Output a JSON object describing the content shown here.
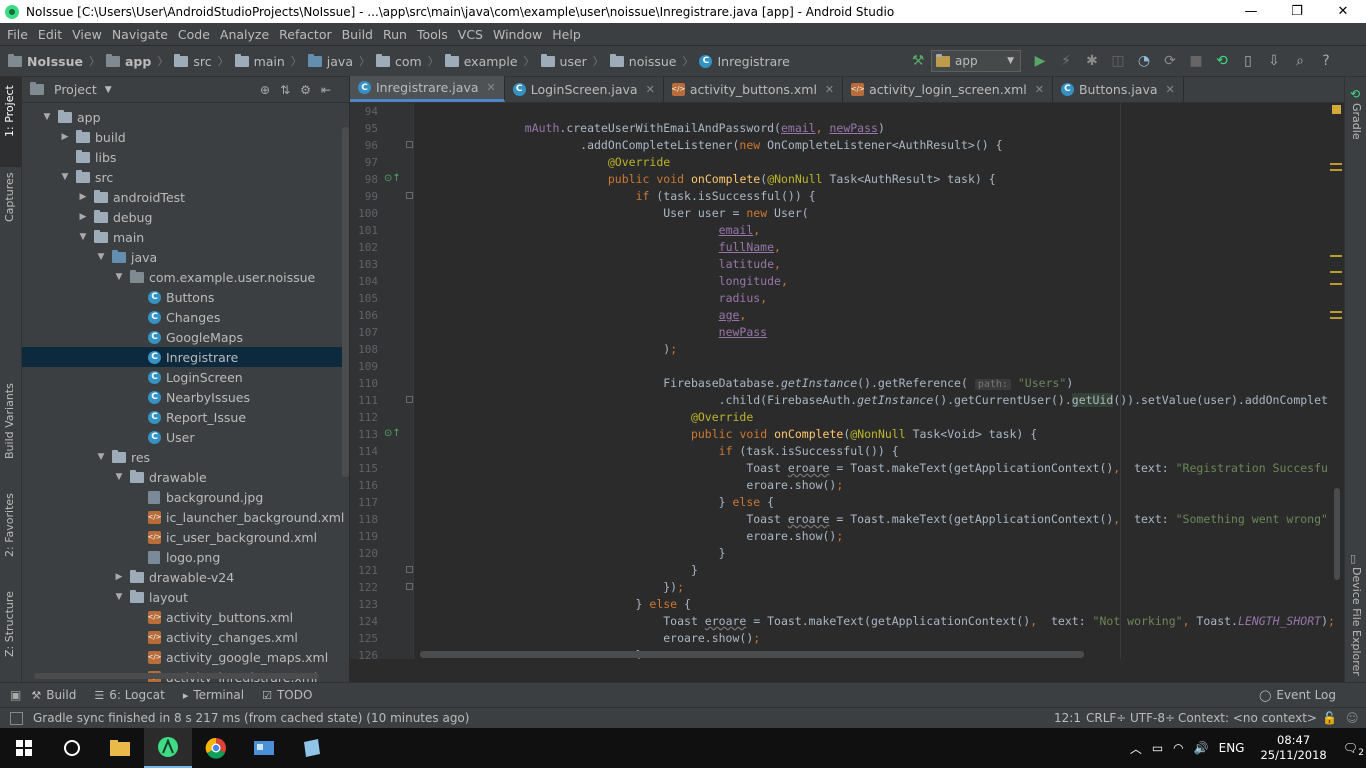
{
  "window": {
    "title": "NoIssue [C:\\Users\\User\\AndroidStudioProjects\\NoIssue] - ...\\app\\src\\main\\java\\com\\example\\user\\noissue\\Inregistrare.java [app] - Android Studio",
    "minimize": "—",
    "restore": "❐",
    "close": "✕"
  },
  "menu": [
    "File",
    "Edit",
    "View",
    "Navigate",
    "Code",
    "Analyze",
    "Refactor",
    "Build",
    "Run",
    "Tools",
    "VCS",
    "Window",
    "Help"
  ],
  "breadcrumb": [
    "NoIssue",
    "app",
    "src",
    "main",
    "java",
    "com",
    "example",
    "user",
    "noissue",
    "Inregistrare"
  ],
  "run_config": "app",
  "left_tool_tabs": [
    "1: Project",
    "Captures",
    "Build Variants",
    "2: Favorites",
    "Z: Structure"
  ],
  "right_tool_tabs": [
    "Gradle",
    "Device File Explorer"
  ],
  "project_panel": {
    "title": "Project",
    "tree": [
      {
        "label": "app",
        "icon": "folder",
        "arrow": "▼",
        "depth": 0
      },
      {
        "label": "build",
        "icon": "folder",
        "arrow": "▶",
        "depth": 1
      },
      {
        "label": "libs",
        "icon": "folder",
        "arrow": "",
        "depth": 1
      },
      {
        "label": "src",
        "icon": "folder",
        "arrow": "▼",
        "depth": 1
      },
      {
        "label": "androidTest",
        "icon": "folder",
        "arrow": "▶",
        "depth": 2
      },
      {
        "label": "debug",
        "icon": "folder",
        "arrow": "▶",
        "depth": 2
      },
      {
        "label": "main",
        "icon": "folder",
        "arrow": "▼",
        "depth": 2
      },
      {
        "label": "java",
        "icon": "folder-blue",
        "arrow": "▼",
        "depth": 3
      },
      {
        "label": "com.example.user.noissue",
        "icon": "package",
        "arrow": "▼",
        "depth": 4
      },
      {
        "label": "Buttons",
        "icon": "class",
        "arrow": "",
        "depth": 5
      },
      {
        "label": "Changes",
        "icon": "class",
        "arrow": "",
        "depth": 5
      },
      {
        "label": "GoogleMaps",
        "icon": "class",
        "arrow": "",
        "depth": 5
      },
      {
        "label": "Inregistrare",
        "icon": "class",
        "arrow": "",
        "depth": 5,
        "selected": true
      },
      {
        "label": "LoginScreen",
        "icon": "class",
        "arrow": "",
        "depth": 5
      },
      {
        "label": "NearbyIssues",
        "icon": "class",
        "arrow": "",
        "depth": 5
      },
      {
        "label": "Report_Issue",
        "icon": "class",
        "arrow": "",
        "depth": 5
      },
      {
        "label": "User",
        "icon": "class",
        "arrow": "",
        "depth": 5
      },
      {
        "label": "res",
        "icon": "folder",
        "arrow": "▼",
        "depth": 3
      },
      {
        "label": "drawable",
        "icon": "folder",
        "arrow": "▼",
        "depth": 4
      },
      {
        "label": "background.jpg",
        "icon": "image",
        "arrow": "",
        "depth": 5
      },
      {
        "label": "ic_launcher_background.xml",
        "icon": "xml",
        "arrow": "",
        "depth": 5
      },
      {
        "label": "ic_user_background.xml",
        "icon": "xml",
        "arrow": "",
        "depth": 5
      },
      {
        "label": "logo.png",
        "icon": "image",
        "arrow": "",
        "depth": 5
      },
      {
        "label": "drawable-v24",
        "icon": "folder",
        "arrow": "▶",
        "depth": 4
      },
      {
        "label": "layout",
        "icon": "folder",
        "arrow": "▼",
        "depth": 4
      },
      {
        "label": "activity_buttons.xml",
        "icon": "xml",
        "arrow": "",
        "depth": 5
      },
      {
        "label": "activity_changes.xml",
        "icon": "xml",
        "arrow": "",
        "depth": 5
      },
      {
        "label": "activity_google_maps.xml",
        "icon": "xml",
        "arrow": "",
        "depth": 5
      },
      {
        "label": "activity_inregistrare.xml",
        "icon": "xml",
        "arrow": "",
        "depth": 5
      }
    ]
  },
  "editor_tabs": [
    {
      "label": "Inregistrare.java",
      "icon": "class",
      "active": true
    },
    {
      "label": "LoginScreen.java",
      "icon": "class",
      "active": false
    },
    {
      "label": "activity_buttons.xml",
      "icon": "xml",
      "active": false
    },
    {
      "label": "activity_login_screen.xml",
      "icon": "xml",
      "active": false
    },
    {
      "label": "Buttons.java",
      "icon": "class",
      "active": false
    }
  ],
  "code": {
    "line_numbers": [
      "94",
      "95",
      "96",
      "97",
      "98",
      "99",
      "100",
      "101",
      "102",
      "103",
      "104",
      "105",
      "106",
      "107",
      "108",
      "109",
      "110",
      "111",
      "112",
      "113",
      "114",
      "115",
      "116",
      "117",
      "118",
      "119",
      "120",
      "121",
      "122",
      "123",
      "124",
      "125",
      "126"
    ],
    "lines": [
      "",
      "                mAuth.createUserWithEmailAndPassword(email, newPass)",
      "                        .addOnCompleteListener(new OnCompleteListener<AuthResult>() {",
      "                            @Override",
      "                            public void onComplete(@NonNull Task<AuthResult> task) {",
      "                                if (task.isSuccessful()) {",
      "                                    User user = new User(",
      "                                            email,",
      "                                            fullName,",
      "                                            latitude,",
      "                                            longitude,",
      "                                            radius,",
      "                                            age,",
      "                                            newPass",
      "                                    );",
      "",
      "                                    FirebaseDatabase.getInstance().getReference( path: \"Users\")",
      "                                            .child(FirebaseAuth.getInstance().getCurrentUser().getUid()).setValue(user).addOnComplet",
      "                                        @Override",
      "                                        public void onComplete(@NonNull Task<Void> task) {",
      "                                            if (task.isSuccessful()) {",
      "                                                Toast eroare = Toast.makeText(getApplicationContext(),  text: \"Registration Succesfu",
      "                                                eroare.show();",
      "                                            } else {",
      "                                                Toast eroare = Toast.makeText(getApplicationContext(),  text: \"Something went wrong\"",
      "                                                eroare.show();",
      "                                            }",
      "                                        }",
      "                                    });",
      "                                } else {",
      "                                    Toast eroare = Toast.makeText(getApplicationContext(),  text: \"Not working\", Toast.LENGTH_SHORT);",
      "                                    eroare.show();",
      "                                }"
    ]
  },
  "bottom_tabs": [
    {
      "label": "Build",
      "icon": "hammer-icon"
    },
    {
      "label": "6: Logcat",
      "icon": "logcat-icon"
    },
    {
      "label": "Terminal",
      "icon": "terminal-icon"
    },
    {
      "label": "TODO",
      "icon": "todo-icon"
    }
  ],
  "event_log": "Event Log",
  "status": {
    "message": "Gradle sync finished in 8 s 217 ms (from cached state) (10 minutes ago)",
    "position": "12:1",
    "line_sep": "CRLF÷",
    "encoding": "UTF-8÷",
    "context": "Context: <no context>"
  },
  "taskbar": {
    "language": "ENG",
    "time": "08:47",
    "date": "25/11/2018",
    "notifications": "2"
  },
  "colors": {
    "keyword": "#cc7832",
    "annotation": "#bbb529",
    "field": "#9876aa",
    "string": "#6a8759",
    "method": "#ffc66d",
    "selection": "#0d293e",
    "active_tab_underline": "#4a88c7"
  }
}
